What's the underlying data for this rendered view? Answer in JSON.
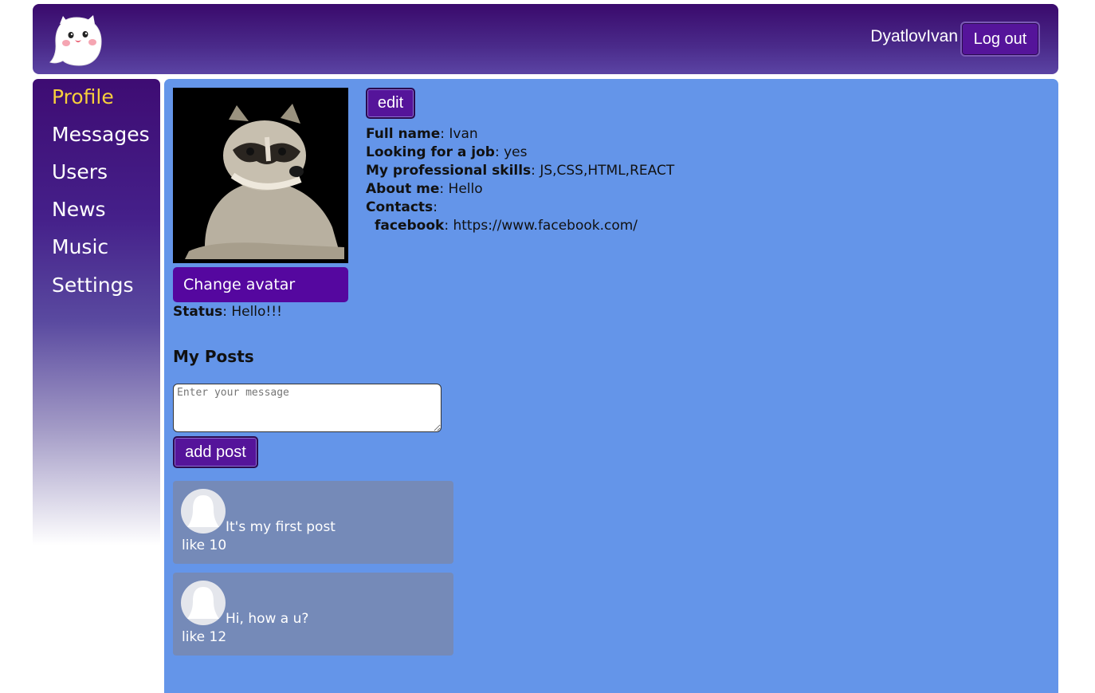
{
  "header": {
    "login_name": "DyatlovIvan",
    "logout_label": "Log out",
    "logo_icon": "ghost-cat-icon"
  },
  "sidebar": {
    "items": [
      {
        "label": "Profile",
        "active": true
      },
      {
        "label": "Messages"
      },
      {
        "label": "Users"
      },
      {
        "label": "News"
      },
      {
        "label": "Music"
      },
      {
        "label": "Settings"
      }
    ]
  },
  "profile": {
    "avatar": "raccoon-photo",
    "change_avatar_label": "Change avatar",
    "status_label": "Status",
    "status_value": "Hello!!!",
    "edit_label": "edit",
    "full_name_label": "Full name",
    "full_name": "Ivan",
    "looking_job_label": "Looking for a job",
    "looking_job": "yes",
    "skills_label": "My professional skills",
    "skills": "JS,CSS,HTML,REACT",
    "about_label": "About me",
    "about": "Hello",
    "contacts_label": "Contacts",
    "facebook_label": "facebook",
    "facebook": "https://www.facebook.com/"
  },
  "posts": {
    "title": "My Posts",
    "input_placeholder": "Enter your message",
    "add_label": "add post",
    "items": [
      {
        "text": "It's my first post",
        "likes": "like 10"
      },
      {
        "text": "Hi, how a u?",
        "likes": "like 12"
      }
    ]
  },
  "colors": {
    "header": "#3a0a6c",
    "content_bg": "#6495e9",
    "active_nav": "#f7cf3c",
    "button": "#55149a",
    "post_bg": "#758ab8"
  }
}
